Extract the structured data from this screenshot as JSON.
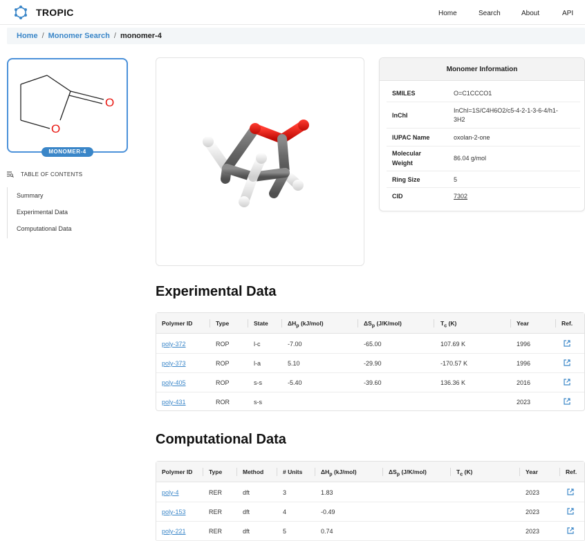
{
  "nav": {
    "brand": "TROPIC",
    "links": [
      "Home",
      "Search",
      "About",
      "API"
    ]
  },
  "breadcrumb": {
    "home": "Home",
    "sep1": "/",
    "search": "Monomer Search",
    "sep2": "/",
    "current": "monomer-4"
  },
  "structure": {
    "atom_label": "O",
    "badge": "MONOMER-4"
  },
  "toc": {
    "title": "TABLE OF CONTENTS",
    "items": [
      "Summary",
      "Experimental Data",
      "Computational Data"
    ]
  },
  "info": {
    "title": "Monomer Information",
    "rows": [
      {
        "label": "SMILES",
        "value": "O=C1CCCO1"
      },
      {
        "label": "InChI",
        "value": "InChI=1S/C4H6O2/c5-4-2-1-3-6-4/h1-",
        "value2": "3H2"
      },
      {
        "label": "IUPAC Name",
        "value": "oxolan-2-one"
      },
      {
        "label": "Molecular",
        "label2": "Weight",
        "value": "86.04 g/mol"
      },
      {
        "label": "Ring Size",
        "value": "5"
      },
      {
        "label": "CID",
        "value": "7302"
      }
    ]
  },
  "experimental": {
    "title": "Experimental Data",
    "headers": {
      "polymer_id": "Polymer ID",
      "type": "Type",
      "state": "State",
      "dh": "ΔH",
      "dh_sub": "p",
      "dh_unit": " (kJ/mol)",
      "ds": "ΔS",
      "ds_sub": "p",
      "ds_unit": " (J/K/mol)",
      "tc": "T",
      "tc_sub": "c",
      "tc_unit": " (K)",
      "year": "Year",
      "ref": "Ref."
    },
    "rows": [
      {
        "id": "poly-372",
        "type": "ROP",
        "state": "l-c",
        "dh": "-7.00",
        "ds": "-65.00",
        "tc": "107.69 K",
        "year": "1996"
      },
      {
        "id": "poly-373",
        "type": "ROP",
        "state": "l-a",
        "dh": "5.10",
        "ds": "-29.90",
        "tc": "-170.57 K",
        "year": "1996"
      },
      {
        "id": "poly-405",
        "type": "ROP",
        "state": "s-s",
        "dh": "-5.40",
        "ds": "-39.60",
        "tc": "136.36 K",
        "year": "2016"
      },
      {
        "id": "poly-431",
        "type": "ROR",
        "state": "s-s",
        "dh": "",
        "ds": "",
        "tc": "",
        "year": "2023"
      }
    ]
  },
  "computational": {
    "title": "Computational Data",
    "headers": {
      "polymer_id": "Polymer ID",
      "type": "Type",
      "method": "Method",
      "units": "# Units",
      "dh": "ΔH",
      "dh_sub": "p",
      "dh_unit": " (kJ/mol)",
      "ds": "ΔS",
      "ds_sub": "p",
      "ds_unit": " (J/K/mol)",
      "tc": "T",
      "tc_sub": "c",
      "tc_unit": " (K)",
      "year": "Year",
      "ref": "Ref."
    },
    "rows": [
      {
        "id": "poly-4",
        "type": "RER",
        "method": "dft",
        "units": "3",
        "dh": "1.83",
        "year": "2023"
      },
      {
        "id": "poly-153",
        "type": "RER",
        "method": "dft",
        "units": "4",
        "dh": "-0.49",
        "year": "2023"
      },
      {
        "id": "poly-221",
        "type": "RER",
        "method": "dft",
        "units": "5",
        "dh": "0.74",
        "year": "2023"
      }
    ]
  },
  "colors": {
    "accent": "#3a86c8",
    "oxygen": "#e8150f",
    "carbon": "#777777",
    "hydrogen": "#f0f0f0"
  }
}
